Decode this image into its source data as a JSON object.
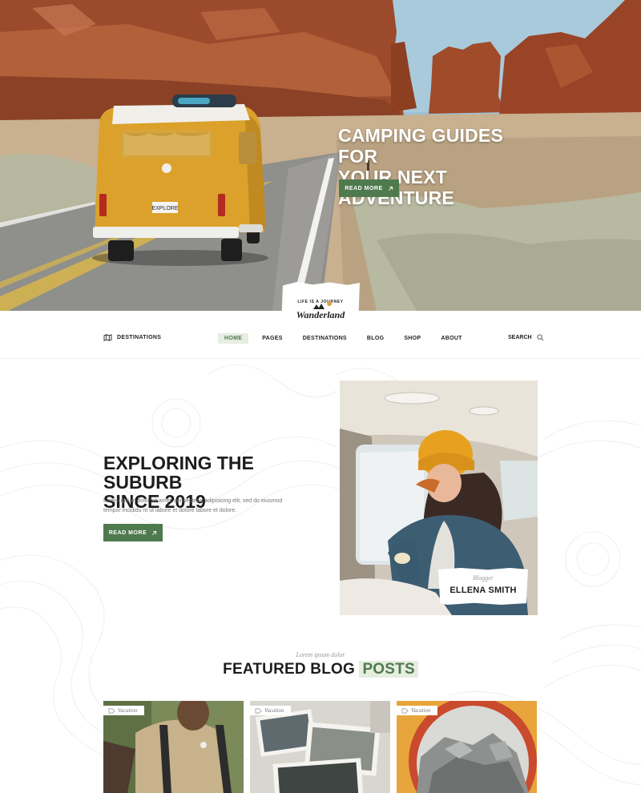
{
  "hero": {
    "title_line1": "CAMPING GUIDES FOR",
    "title_line2": "YOUR NEXT ADVENTURE",
    "button_label": "READ MORE",
    "van_plate": "EXPLORE"
  },
  "logo": {
    "tagline": "LIFE IS A JOURNEY",
    "name": "Wanderland"
  },
  "nav": {
    "destinations_label": "DESTINATIONS",
    "items": [
      {
        "label": "HOME",
        "active": true
      },
      {
        "label": "PAGES",
        "active": false
      },
      {
        "label": "DESTINATIONS",
        "active": false
      },
      {
        "label": "BLOG",
        "active": false
      },
      {
        "label": "SHOP",
        "active": false
      },
      {
        "label": "ABOUT",
        "active": false
      }
    ],
    "search_label": "SEARCH"
  },
  "about": {
    "title_line1": "EXPLORING THE SUBURB",
    "title_line2": "SINCE 2019",
    "text": "Lorem ipsum dolor sit amet, consectetur adipisicing elit, sed do eiusmod tempor incididu nt ut labore et dolore labore et dolore.",
    "button_label": "READ MORE",
    "author_role": "Blogger",
    "author_name": "ELLENA SMITH"
  },
  "featured": {
    "subtitle": "Lorem ipsum dolor",
    "title_main": "FEATURED BLOG",
    "title_accent": "POSTS",
    "cards": [
      {
        "tag": "Vacation"
      },
      {
        "tag": "Vacation"
      },
      {
        "tag": "Vacation"
      }
    ]
  },
  "colors": {
    "accent_green": "#4f7a4e",
    "accent_green_light": "#e6ede1",
    "text_dark": "#1d1d1d",
    "text_muted": "#777777"
  },
  "icons": {
    "button_arrow": "arrow-up-right-icon",
    "destinations": "map-icon",
    "search": "search-icon",
    "tag": "tag-icon"
  }
}
